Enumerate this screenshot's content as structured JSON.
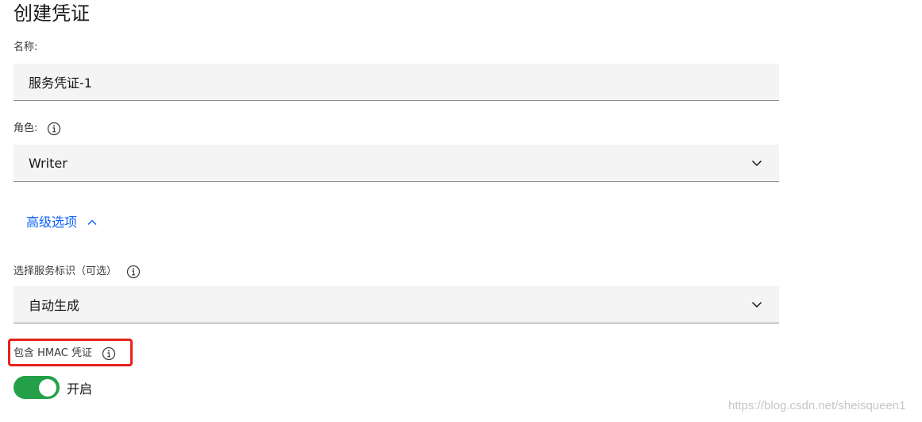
{
  "page": {
    "title": "创建凭证"
  },
  "name_field": {
    "label": "名称:",
    "value": "服务凭证-1"
  },
  "role_field": {
    "label": "角色:",
    "value": "Writer"
  },
  "advanced": {
    "label": "高级选项"
  },
  "service_id_field": {
    "label": "选择服务标识（可选）",
    "value": "自动生成"
  },
  "hmac": {
    "label": "包含 HMAC 凭证",
    "toggle_state": "开启",
    "on": true
  },
  "watermark": "https://blog.csdn.net/sheisqueen1",
  "colors": {
    "accent_link": "#0f62fe",
    "toggle_on": "#24a148",
    "highlight": "#e8231a",
    "field_bg": "#f4f4f4"
  }
}
